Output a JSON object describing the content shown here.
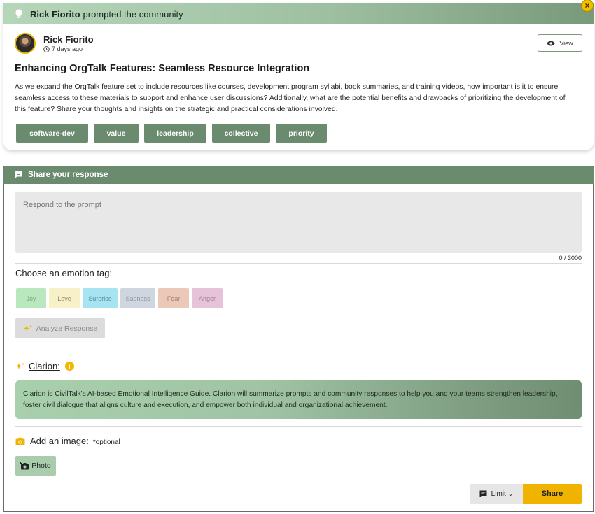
{
  "prompt": {
    "banner": {
      "author": "Rick Fiorito",
      "action": "prompted the community",
      "icon": "lightbulb-icon"
    },
    "close_icon": "close-icon",
    "author": {
      "name": "Rick Fiorito",
      "time": "7 days ago"
    },
    "view_label": "View",
    "title": "Enhancing OrgTalk Features: Seamless Resource Integration",
    "body": "As we expand the OrgTalk feature set to include resources like courses, development program syllabi, book summaries, and training videos, how important is it to ensure seamless access to these materials to support and enhance user discussions? Additionally, what are the potential benefits and drawbacks of prioritizing the development of this feature? Share your thoughts and insights on the strategic and practical considerations involved.",
    "tags": [
      "software-dev",
      "value",
      "leadership",
      "collective",
      "priority"
    ]
  },
  "response": {
    "header": "Share your response",
    "placeholder": "Respond to the prompt",
    "counter": "0 / 3000",
    "emotion_label": "Choose an emotion tag:",
    "emotions": [
      {
        "label": "Joy",
        "color": "#b9e8be",
        "text": "#7aa87e"
      },
      {
        "label": "Love",
        "color": "#f8f0c8",
        "text": "#8a8a6a"
      },
      {
        "label": "Surprise",
        "color": "#a7e4f2",
        "text": "#5e8a96"
      },
      {
        "label": "Sadness",
        "color": "#cfd6df",
        "text": "#8a96a0"
      },
      {
        "label": "Fear",
        "color": "#ecc8b8",
        "text": "#a08070"
      },
      {
        "label": "Anger",
        "color": "#e6c3d9",
        "text": "#a07e98"
      }
    ],
    "analyze_label": "Analyze Response",
    "clarion_label": "Clarion:",
    "clarion_info": "i",
    "clarion_text": "Clarion is CivilTalk's AI-based Emotional Intelligence Guide. Clarion will summarize prompts and community responses to help you and your teams strengthen leadership, foster civil dialogue that aligns culture and execution, and empower both individual and organizational achievement.",
    "image_label": "Add an image:",
    "optional_label": "*optional",
    "photo_label": "Photo",
    "limit_label": "Limit",
    "share_label": "Share"
  },
  "colors": {
    "brand_green": "#6a8b6e",
    "accent_yellow": "#f0b400"
  }
}
